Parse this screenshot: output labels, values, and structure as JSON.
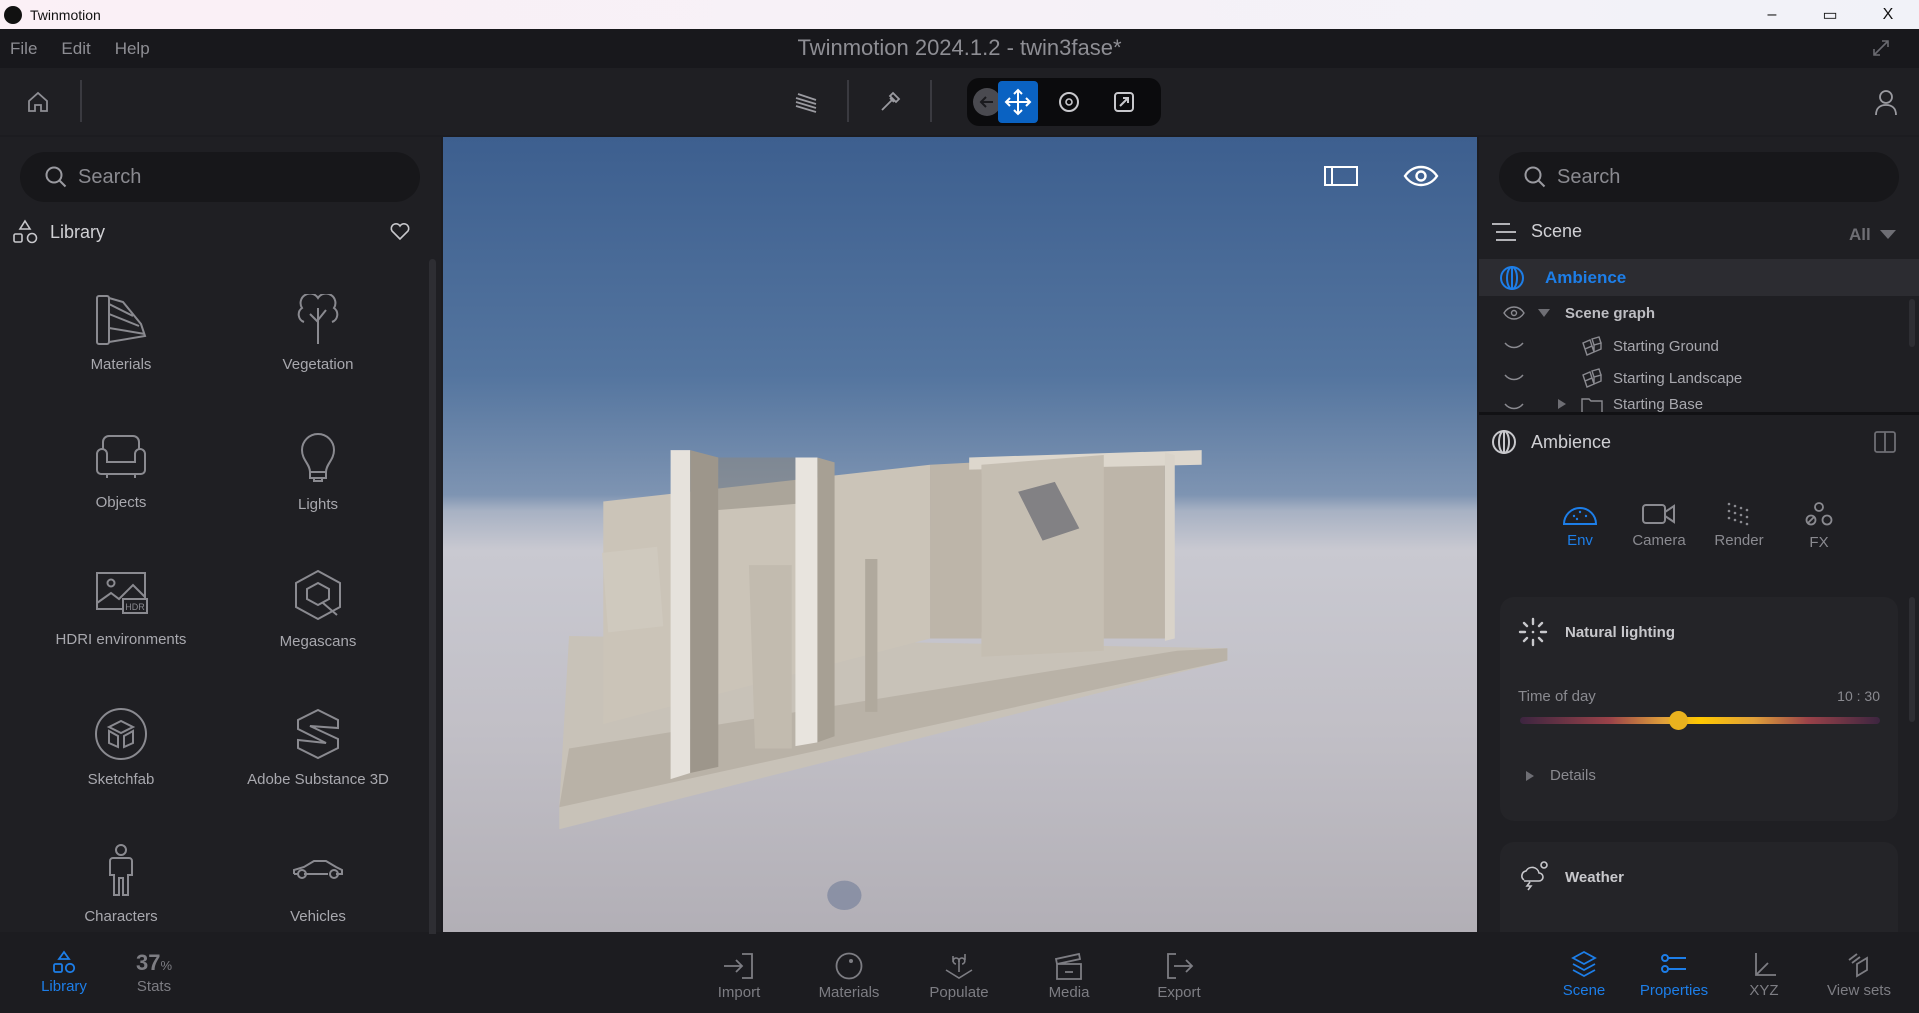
{
  "window": {
    "app_name": "Twinmotion",
    "title": "Twinmotion 2024.1.2 - twin3fase*",
    "minimize": "–",
    "maximize": "▭",
    "close": "X"
  },
  "menu": [
    "File",
    "Edit",
    "Help"
  ],
  "toolbar": {
    "icons": [
      "home-icon",
      "layers-icon",
      "eyedropper-icon",
      "back-icon",
      "move-icon",
      "rotate-icon",
      "scale-icon",
      "user-icon"
    ],
    "active_tool": "move",
    "accent": "#0a62c2"
  },
  "library": {
    "search_placeholder": "Search",
    "title": "Library",
    "items": [
      {
        "label": "Materials",
        "icon": "fan-deck-icon"
      },
      {
        "label": "Vegetation",
        "icon": "tree-icon"
      },
      {
        "label": "Objects",
        "icon": "sofa-icon"
      },
      {
        "label": "Lights",
        "icon": "bulb-icon"
      },
      {
        "label": "HDRI environments",
        "icon": "hdr-image-icon"
      },
      {
        "label": "Megascans",
        "icon": "megascans-icon"
      },
      {
        "label": "Sketchfab",
        "icon": "sketchfab-icon"
      },
      {
        "label": "Adobe Substance 3D",
        "icon": "substance-icon"
      },
      {
        "label": "Characters",
        "icon": "person-icon"
      },
      {
        "label": "Vehicles",
        "icon": "car-icon"
      }
    ]
  },
  "scene": {
    "search_placeholder": "Search",
    "title": "Scene",
    "filter": "All",
    "tree": [
      {
        "label": "Ambience",
        "selected": true
      },
      {
        "label": "Scene graph",
        "expanded": true
      },
      {
        "label": "Starting Ground"
      },
      {
        "label": "Starting Landscape"
      },
      {
        "label": "Starting Base",
        "expanded": false
      }
    ]
  },
  "properties": {
    "title": "Ambience",
    "tabs": [
      {
        "label": "Env",
        "active": true
      },
      {
        "label": "Camera"
      },
      {
        "label": "Render"
      },
      {
        "label": "FX"
      }
    ],
    "natural_lighting": {
      "title": "Natural lighting",
      "time_label": "Time of day",
      "time_value": "10 : 30",
      "slider_fraction": 0.44,
      "details": "Details"
    },
    "weather": {
      "title": "Weather"
    }
  },
  "bottom": {
    "left": [
      {
        "label": "Library",
        "active": true
      },
      {
        "label": "Stats",
        "value": "37",
        "unit": "%"
      }
    ],
    "center": [
      "Import",
      "Materials",
      "Populate",
      "Media",
      "Export"
    ],
    "right": [
      {
        "label": "Scene",
        "active": true
      },
      {
        "label": "Properties",
        "active": true
      },
      {
        "label": "XYZ"
      },
      {
        "label": "View sets"
      }
    ]
  },
  "colors": {
    "accent": "#1d7ee8",
    "panel": "#1f1f23",
    "slider_warm": "#f4c21a"
  }
}
